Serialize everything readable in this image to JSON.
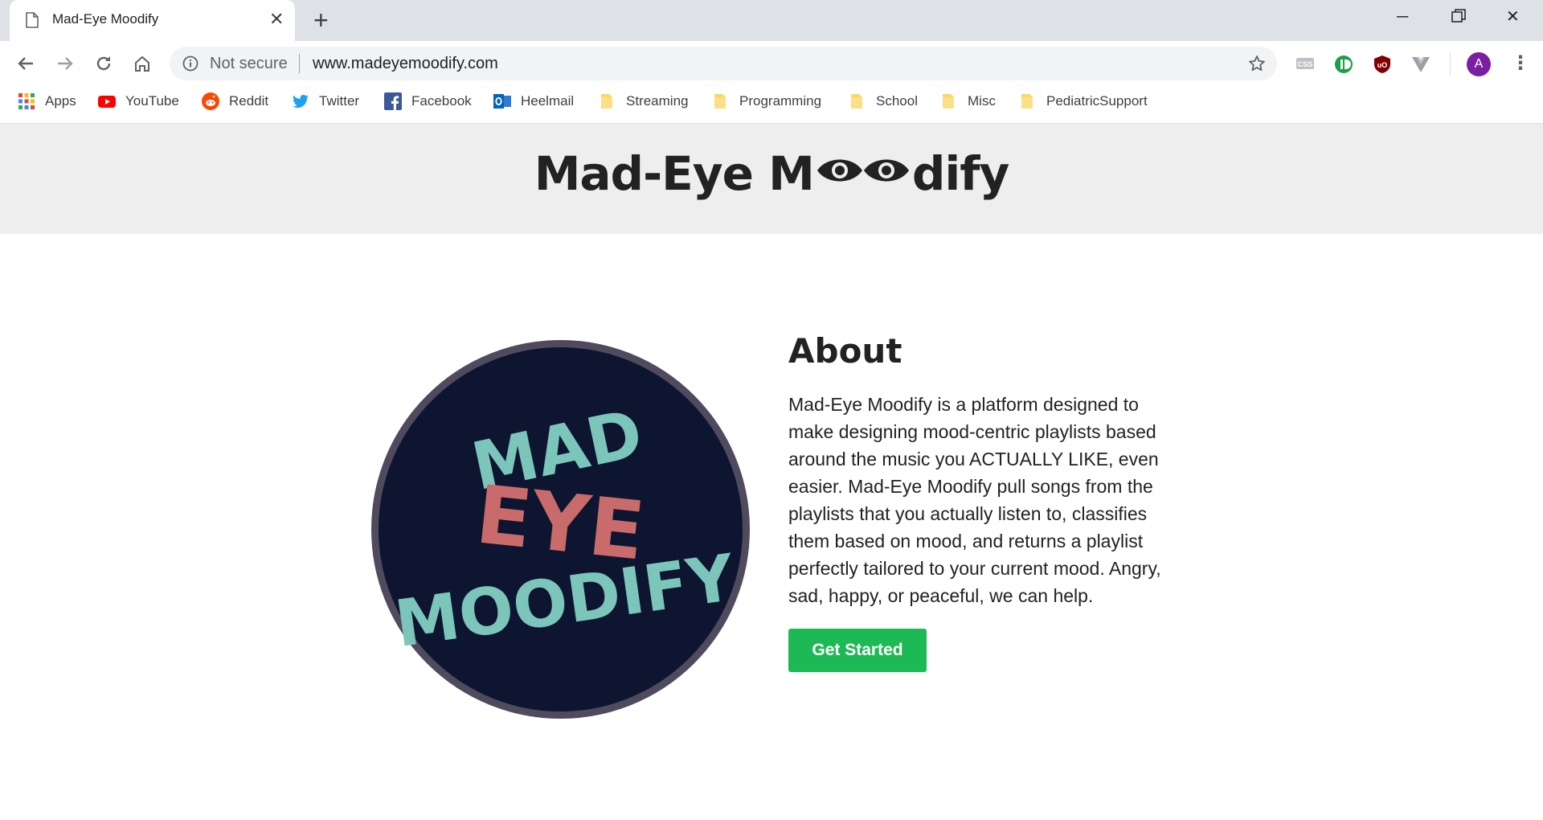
{
  "browser": {
    "tab_title": "Mad-Eye Moodify",
    "url_security": "Not secure",
    "url": "www.madeyemoodify.com",
    "profile_initial": "A"
  },
  "bookmarks": [
    {
      "label": "Apps",
      "icon": "apps-grid-icon"
    },
    {
      "label": "YouTube",
      "icon": "youtube-icon"
    },
    {
      "label": "Reddit",
      "icon": "reddit-icon"
    },
    {
      "label": "Twitter",
      "icon": "twitter-icon"
    },
    {
      "label": "Facebook",
      "icon": "facebook-icon"
    },
    {
      "label": "Heelmail",
      "icon": "outlook-icon"
    },
    {
      "label": "Streaming",
      "icon": "folder-icon"
    },
    {
      "label": "Programming",
      "icon": "folder-icon"
    },
    {
      "label": "School",
      "icon": "folder-icon"
    },
    {
      "label": "Misc",
      "icon": "folder-icon"
    },
    {
      "label": "PediatricSupport",
      "icon": "folder-icon"
    }
  ],
  "site": {
    "title_before": "Mad-Eye M",
    "title_after": "dify",
    "logo_text": {
      "line1": "MAD",
      "line2": "EYE",
      "line3": "MOODIFY"
    },
    "about": {
      "heading": "About",
      "body": "Mad-Eye Moodify is a platform designed to make designing mood-centric playlists based around the music you ACTUALLY LIKE, even easier. Mad-Eye Moodify pull songs from the playlists that you actually listen to, classifies them based on mood, and returns a playlist perfectly tailored to your current mood. Angry, sad, happy, or peaceful, we can help.",
      "button": "Get Started"
    }
  },
  "colors": {
    "accent_green": "#1db954",
    "logo_bg": "#0e1530",
    "logo_ring": "#4f4a5e",
    "logo_teal": "#7cc5ba",
    "logo_red": "#c96b6b",
    "header_bg": "#eeeeee"
  }
}
